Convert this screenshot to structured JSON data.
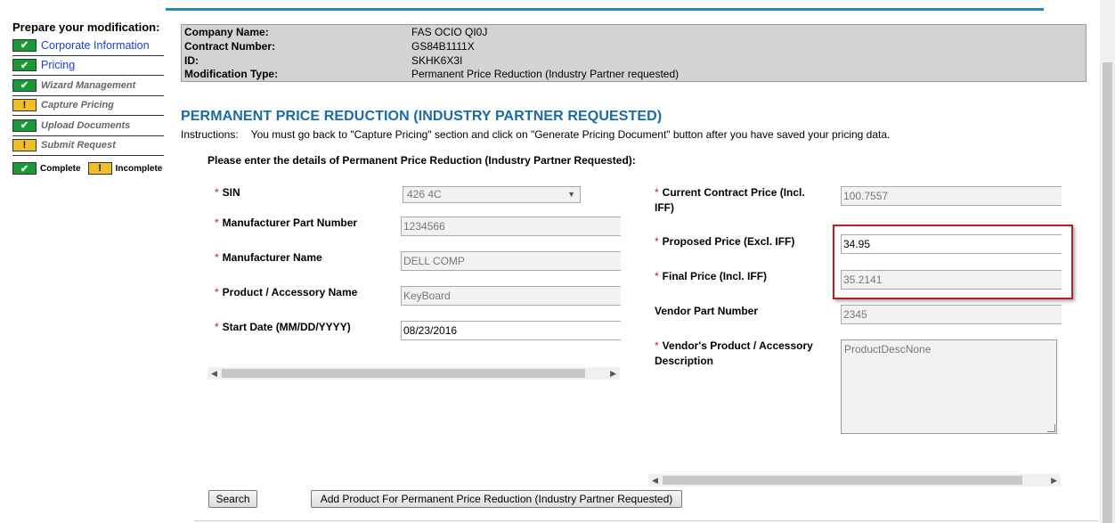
{
  "sidebar": {
    "title": "Prepare your modification:",
    "items": [
      {
        "label": "Corporate Information",
        "status": "complete",
        "style": "link"
      },
      {
        "label": "Pricing",
        "status": "complete",
        "style": "link"
      },
      {
        "label": "Wizard Management",
        "status": "complete",
        "style": "muted"
      },
      {
        "label": "Capture Pricing",
        "status": "incomplete",
        "style": "muted"
      },
      {
        "label": "Upload Documents",
        "status": "complete",
        "style": "muted"
      },
      {
        "label": "Submit Request",
        "status": "incomplete",
        "style": "muted"
      }
    ],
    "legend": {
      "complete": "Complete",
      "incomplete": "Incomplete"
    },
    "check_glyph": "✔",
    "warn_glyph": "!"
  },
  "info": {
    "rows": [
      {
        "key": "Company Name:",
        "value": "FAS OCIO QI0J"
      },
      {
        "key": "Contract Number:",
        "value": "GS84B1111X"
      },
      {
        "key": "ID:",
        "value": "SKHK6X3I"
      },
      {
        "key": "Modification Type:",
        "value": "Permanent Price Reduction (Industry Partner requested)"
      }
    ]
  },
  "page": {
    "title": "PERMANENT PRICE REDUCTION (INDUSTRY PARTNER REQUESTED)",
    "instructions_label": "Instructions:",
    "instructions_text": "You must go back to \"Capture Pricing\" section and click on \"Generate Pricing Document\" button after you have saved your pricing data.",
    "enter_details": "Please enter the details of Permanent Price Reduction (Industry Partner Requested):"
  },
  "form": {
    "sin": {
      "label": "SIN",
      "value": "426 4C"
    },
    "mfr_part": {
      "label": "Manufacturer Part Number",
      "value": "1234566"
    },
    "mfr_name": {
      "label": "Manufacturer Name",
      "value": "DELL COMP"
    },
    "product_name": {
      "label": "Product / Accessory Name",
      "value": "KeyBoard"
    },
    "start_date": {
      "label": "Start Date (MM/DD/YYYY)",
      "value": "08/23/2016"
    },
    "current_price": {
      "label_1": "Current Contract Price (Incl.",
      "label_2": "IFF)",
      "value": "100.7557"
    },
    "proposed_price": {
      "label": "Proposed Price (Excl. IFF)",
      "value": "34.95"
    },
    "final_price": {
      "label": "Final Price (Incl. IFF)",
      "value": "35.2141"
    },
    "vendor_part": {
      "label": "Vendor Part Number",
      "value": "2345"
    },
    "vendor_desc": {
      "label_1": "Vendor's Product / Accessory",
      "label_2": "Description",
      "value": "ProductDescNone"
    },
    "required_mark": "*"
  },
  "buttons": {
    "search": "Search",
    "add_product": "Add Product For Permanent Price Reduction (Industry Partner Requested)"
  },
  "scroll_glyphs": {
    "left": "◀",
    "right": "▶",
    "down": "▼"
  }
}
